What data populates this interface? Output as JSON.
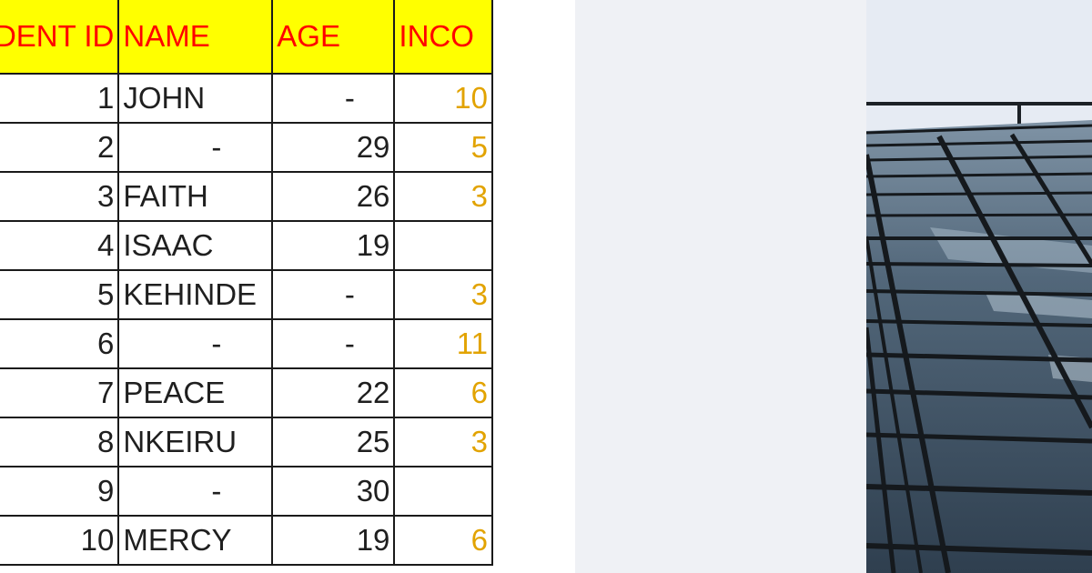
{
  "spreadsheet": {
    "columns": [
      "NDENT ID",
      "NAME",
      "AGE",
      "INCO"
    ],
    "rows": [
      {
        "id": "1",
        "name": "JOHN",
        "age": "-",
        "income": "10"
      },
      {
        "id": "2",
        "name": "-",
        "age": "29",
        "income": "5"
      },
      {
        "id": "3",
        "name": "FAITH",
        "age": "26",
        "income": "3"
      },
      {
        "id": "4",
        "name": "ISAAC",
        "age": "19",
        "income": ""
      },
      {
        "id": "5",
        "name": "KEHINDE",
        "age": "-",
        "income": "3"
      },
      {
        "id": "6",
        "name": "-",
        "age": "-",
        "income": "11"
      },
      {
        "id": "7",
        "name": "PEACE",
        "age": "22",
        "income": "6"
      },
      {
        "id": "8",
        "name": "NKEIRU",
        "age": "25",
        "income": "3"
      },
      {
        "id": "9",
        "name": "-",
        "age": "30",
        "income": ""
      },
      {
        "id": "10",
        "name": "MERCY",
        "age": "19",
        "income": "6"
      }
    ],
    "colors": {
      "header_bg": "#ffff00",
      "header_text": "#ff0000",
      "income_text": "#e2a300",
      "grid": "#1a1a1a"
    }
  },
  "photo": {
    "subject": "glass-building-facade-image",
    "colors": {
      "sky": "#e6ebf3",
      "glass": "#3f5163",
      "frame": "#15191d"
    }
  },
  "background": "#eff1f5"
}
